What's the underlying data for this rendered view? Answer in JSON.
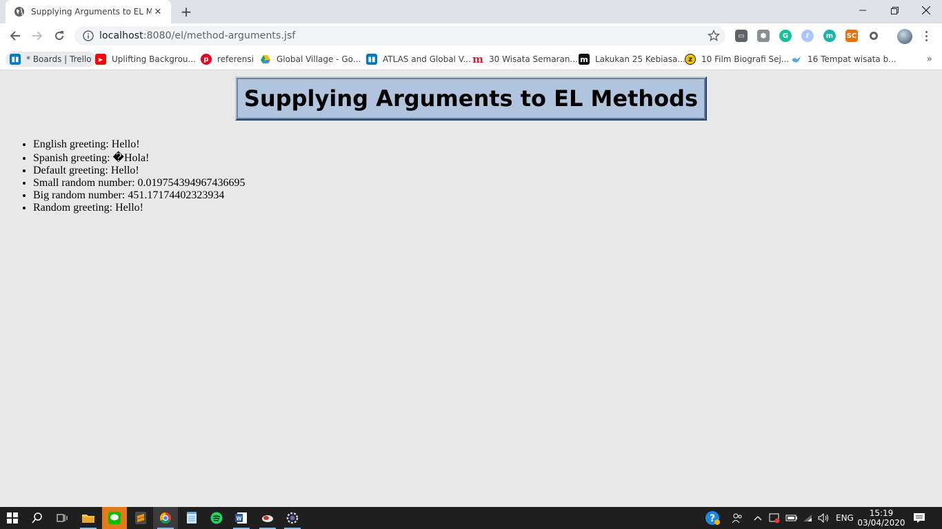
{
  "browser": {
    "tab_title": "Supplying Arguments to EL Meth",
    "url_host": "localhost",
    "url_rest": ":8080/el/method-arguments.jsf"
  },
  "bookmarks": [
    {
      "label": "* Boards | Trello",
      "icon": "trello-icon",
      "color": "#0079bf"
    },
    {
      "label": "Uplifting Backgrou...",
      "icon": "youtube-icon",
      "color": "#ff0000"
    },
    {
      "label": "referensi",
      "icon": "pinterest-icon",
      "color": "#e60023"
    },
    {
      "label": "Global Village - Go...",
      "icon": "google-drive-icon",
      "color": "#1fa463"
    },
    {
      "label": "ATLAS and Global V...",
      "icon": "trello-icon",
      "color": "#0079bf"
    },
    {
      "label": "30 Wisata Semaran...",
      "icon": "m-red-icon",
      "color": "#d01f2f"
    },
    {
      "label": "Lakukan 25 Kebiasa...",
      "icon": "m-black-icon",
      "color": "#111111"
    },
    {
      "label": "10 Film Biografi Sej...",
      "icon": "z-yellow-icon",
      "color": "#f2c200"
    },
    {
      "label": "16 Tempat wisata b...",
      "icon": "bird-icon",
      "color": "#5aa9e6"
    }
  ],
  "page": {
    "heading": "Supplying Arguments to EL Methods",
    "items": [
      "English greeting: Hello!",
      "Spanish greeting: �Hola!",
      "Default greeting: Hello!",
      "Small random number: 0.019754394967436695",
      "Big random number: 451.17174402323934",
      "Random greeting: Hello!"
    ]
  },
  "taskbar": {
    "language": "ENG",
    "time": "15:19",
    "date": "03/04/2020"
  },
  "colors": {
    "heading_bg": "#b0c4de",
    "page_bg": "#e8e8e8",
    "taskbar_bg": "#1f1f1f"
  }
}
